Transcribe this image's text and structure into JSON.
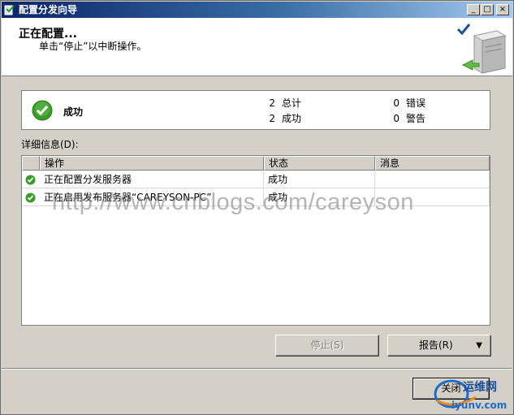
{
  "window": {
    "title": "配置分发向导",
    "controls": {
      "minimize": "_",
      "maximize": "□",
      "close": "×"
    }
  },
  "header": {
    "title": "正在配置...",
    "subtitle": "单击“停止”以中断操作。"
  },
  "status": {
    "text": "成功",
    "total_count": "2",
    "total_label": "总计",
    "success_count": "2",
    "success_label": "成功",
    "error_count": "0",
    "error_label": "错误",
    "warning_count": "0",
    "warning_label": "警告"
  },
  "details": {
    "label": "详细信息(D):",
    "columns": [
      "操作",
      "状态",
      "消息"
    ],
    "rows": [
      {
        "action": "正在配置分发服务器",
        "status": "成功",
        "message": ""
      },
      {
        "action": "正在启用发布服务器“CAREYSON-PC”",
        "status": "成功",
        "message": ""
      }
    ]
  },
  "watermark": "http://www.cnblogs.com/careyson",
  "buttons": {
    "stop": "停止(S)",
    "report": "报告(R)",
    "report_arrow": "▼",
    "close": "关闭"
  },
  "logo": {
    "cn": "运维网",
    "en": "iyunv.com"
  },
  "colors": {
    "titlebar": "#0a246a",
    "success_green": "#3a9a2a",
    "dialog_bg": "#d4d0c8"
  }
}
